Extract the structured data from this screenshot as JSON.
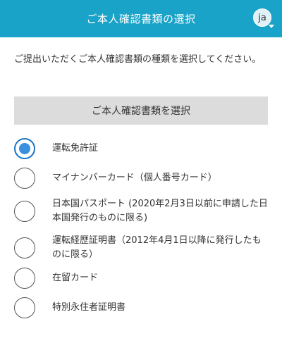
{
  "header": {
    "title": "ご本人確認書類の選択",
    "language_code": "ja"
  },
  "description": "ご提出いただくご本人確認書類の種類を選択してください。",
  "select_button_label": "ご本人確認書類を選択",
  "options": [
    {
      "label": "運転免許証",
      "selected": true
    },
    {
      "label": "マイナンバーカード（個人番号カード）",
      "selected": false
    },
    {
      "label": "日本国パスポート (2020年2月3日以前に申請した日本国発行のものに限る)",
      "selected": false
    },
    {
      "label": "運転経歴証明書（2012年4月1日以降に発行したものに限る）",
      "selected": false
    },
    {
      "label": "在留カード",
      "selected": false
    },
    {
      "label": "特別永住者証明書",
      "selected": false
    }
  ],
  "colors": {
    "header_bg": "#1aa3c8",
    "radio_selected": "#3a8fe0",
    "button_bg": "#dcdcdc"
  }
}
